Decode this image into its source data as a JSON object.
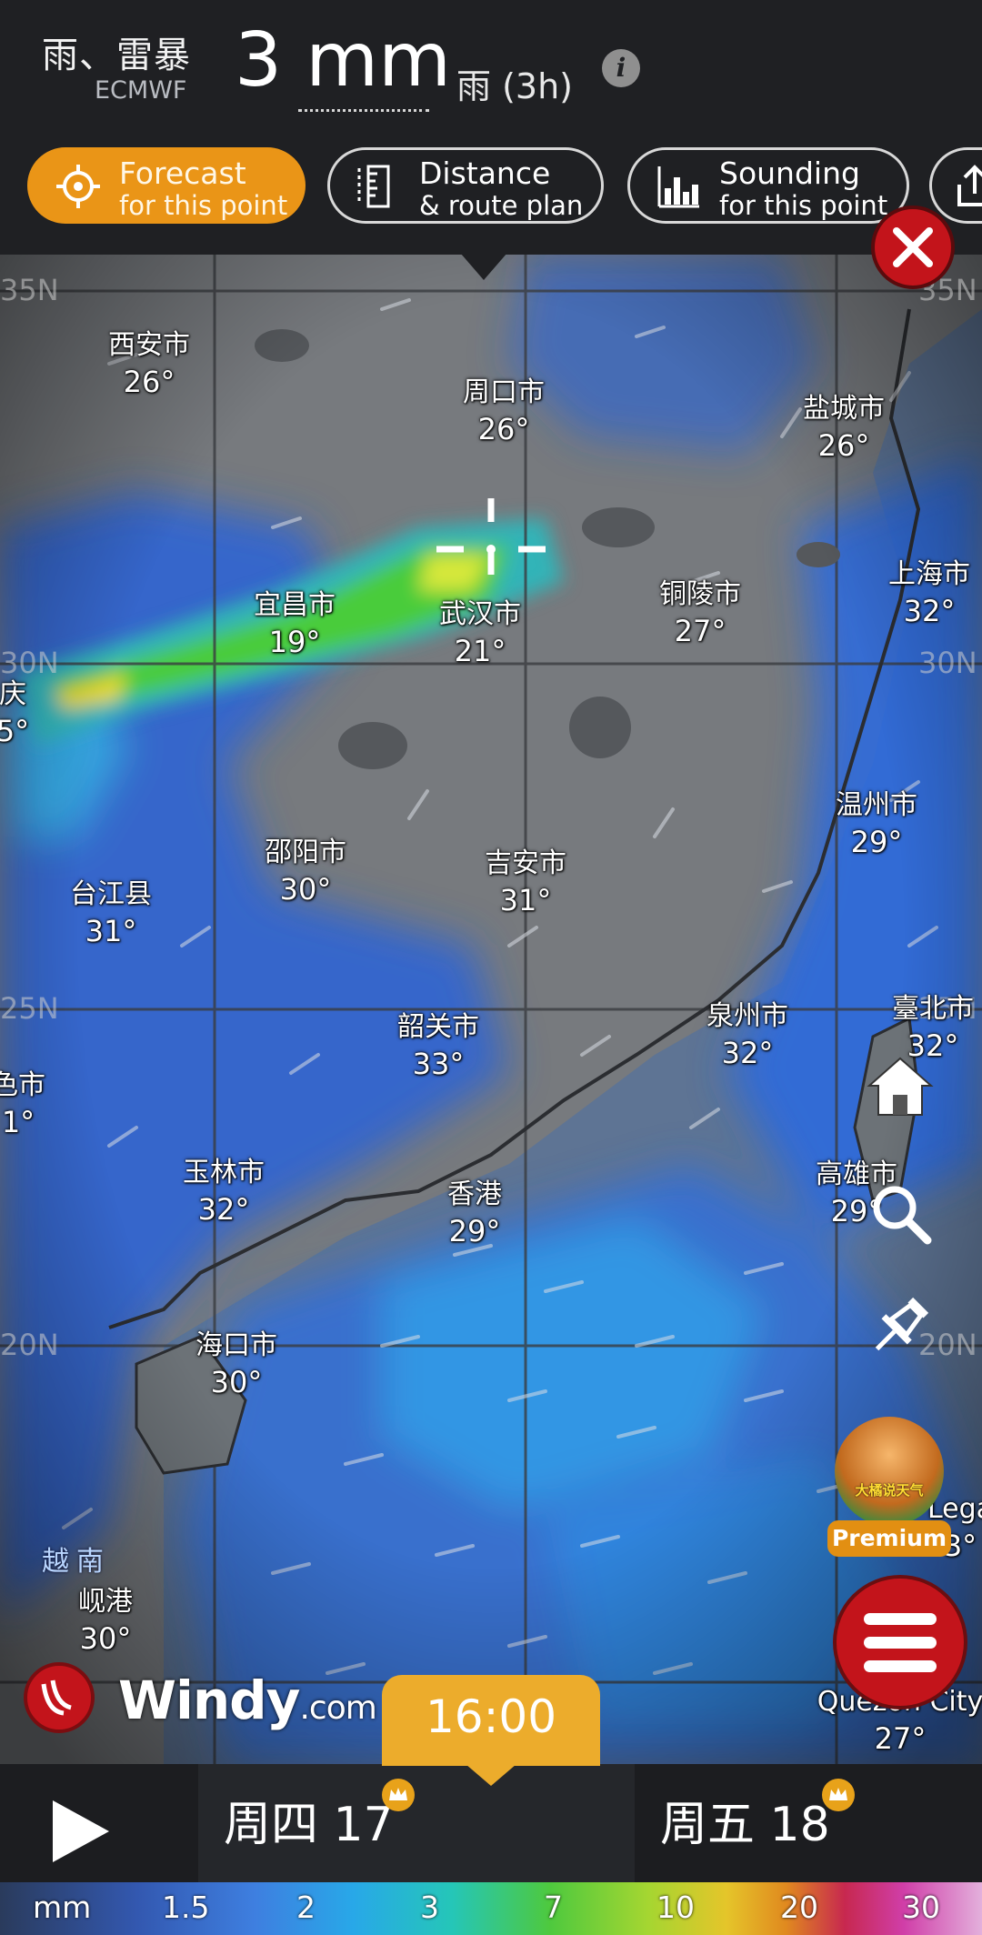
{
  "header": {
    "layer_type": "雨、雷暴",
    "model": "ECMWF",
    "value": "3 mm",
    "sub": "雨 (3h)",
    "info_icon": "i"
  },
  "chips": {
    "forecast": {
      "line1": "Forecast",
      "line2": "for this point",
      "icon": "crosshair-icon"
    },
    "distance": {
      "line1": "Distance",
      "line2": "& route plan",
      "icon": "ruler-icon"
    },
    "sounding": {
      "line1": "Sounding",
      "line2": "for this point",
      "icon": "bar-chart-icon"
    },
    "share": {
      "icon": "share-icon"
    }
  },
  "map": {
    "cities": [
      {
        "name": "西安市",
        "temp": "26°"
      },
      {
        "name": "周口市",
        "temp": "26°"
      },
      {
        "name": "盐城市",
        "temp": "26°"
      },
      {
        "name": "上海市",
        "temp": "32°"
      },
      {
        "name": "宜昌市",
        "temp": "19°"
      },
      {
        "name": "武汉市",
        "temp": "21°"
      },
      {
        "name": "铜陵市",
        "temp": "27°"
      },
      {
        "name": "庆",
        "temp": "5°"
      },
      {
        "name": "温州市",
        "temp": "29°"
      },
      {
        "name": "邵阳市",
        "temp": "30°"
      },
      {
        "name": "吉安市",
        "temp": "31°"
      },
      {
        "name": "台江县",
        "temp": "31°"
      },
      {
        "name": "臺北市",
        "temp": "32°"
      },
      {
        "name": "泉州市",
        "temp": "32°"
      },
      {
        "name": "韶关市",
        "temp": "33°"
      },
      {
        "name": "色市",
        "temp": "1°"
      },
      {
        "name": "高雄市",
        "temp": "29°"
      },
      {
        "name": "玉林市",
        "temp": "32°"
      },
      {
        "name": "香港",
        "temp": "29°"
      },
      {
        "name": "海口市",
        "temp": "30°"
      },
      {
        "name": "岘港",
        "temp": "30°"
      },
      {
        "name": "Quezon City",
        "temp": "27°"
      },
      {
        "name": "Lega",
        "temp": "3°"
      }
    ],
    "latitudes": [
      "35N",
      "35N",
      "30N",
      "30N",
      "25N",
      "25N",
      "20N",
      "20N"
    ],
    "country": "越南"
  },
  "controls": {
    "home_icon": "home-icon",
    "search_icon": "search-icon",
    "pin_icon": "pin-icon",
    "avatar_text": "大橘说天气",
    "premium_label": "Premium",
    "menu_icon": "hamburger-menu-icon",
    "close_icon": "close-icon"
  },
  "logo": {
    "text": "Windy",
    "suffix": ".com"
  },
  "timeline": {
    "current_time": "16:00",
    "days": [
      "周四 17",
      "周五 18"
    ],
    "play_icon": "play-icon"
  },
  "legend": {
    "unit": "mm",
    "values": [
      "1.5",
      "2",
      "3",
      "7",
      "10",
      "20",
      "30"
    ]
  },
  "colors": {
    "accent_orange": "#ea9517",
    "time_tab": "#ecac2c",
    "brand_red": "#c3141b",
    "header_bg": "#1f2023"
  }
}
